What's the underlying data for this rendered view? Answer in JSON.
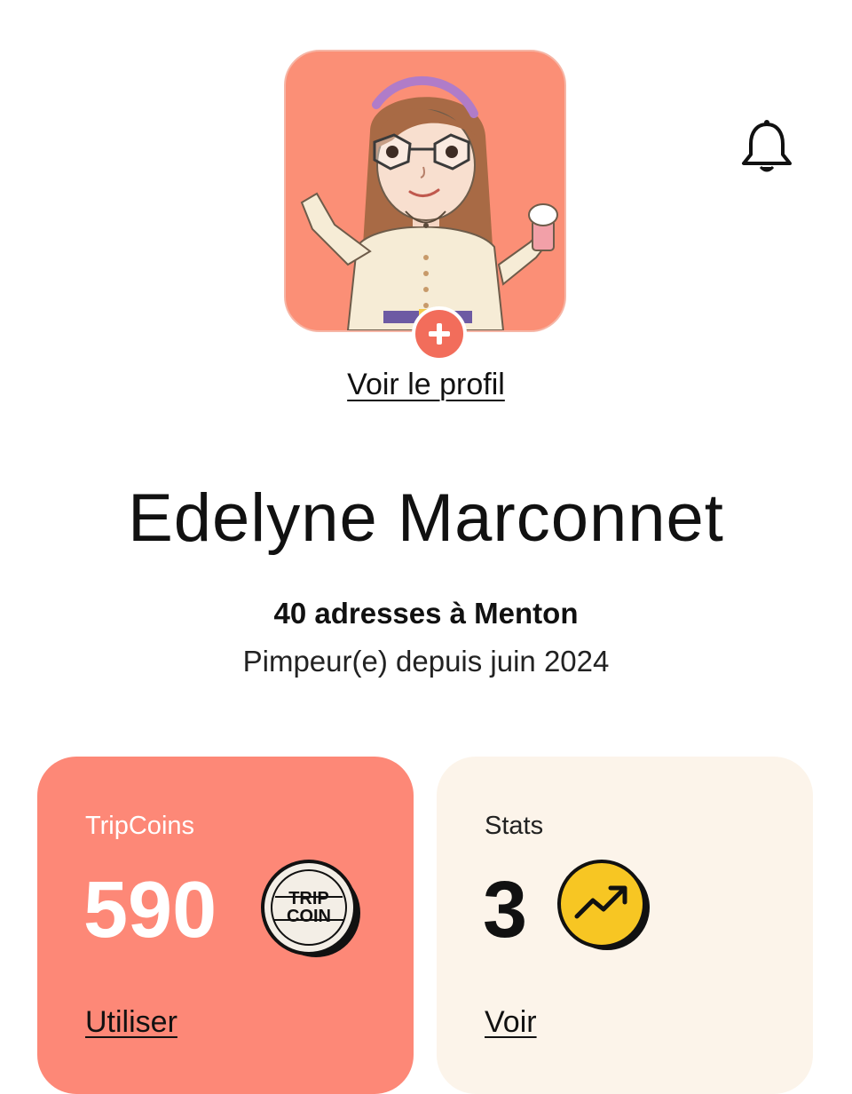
{
  "profile": {
    "avatar_icon": "avatar-illustration",
    "view_profile_label": "Voir le profil",
    "name": "Edelyne Marconnet",
    "addresses": "40 adresses à Menton",
    "member_since": "Pimpeur(e) depuis juin 2024"
  },
  "header": {
    "notification_icon": "bell-icon"
  },
  "cards": {
    "tripcoins": {
      "label": "TripCoins",
      "value": "590",
      "badge_line1": "TRIP",
      "badge_line2": "COIN",
      "link": "Utiliser",
      "color": "#fd8877"
    },
    "stats": {
      "label": "Stats",
      "value": "3",
      "link": "Voir",
      "icon": "trending-up-icon",
      "color": "#fcf4ea",
      "icon_color": "#f7c623"
    }
  }
}
